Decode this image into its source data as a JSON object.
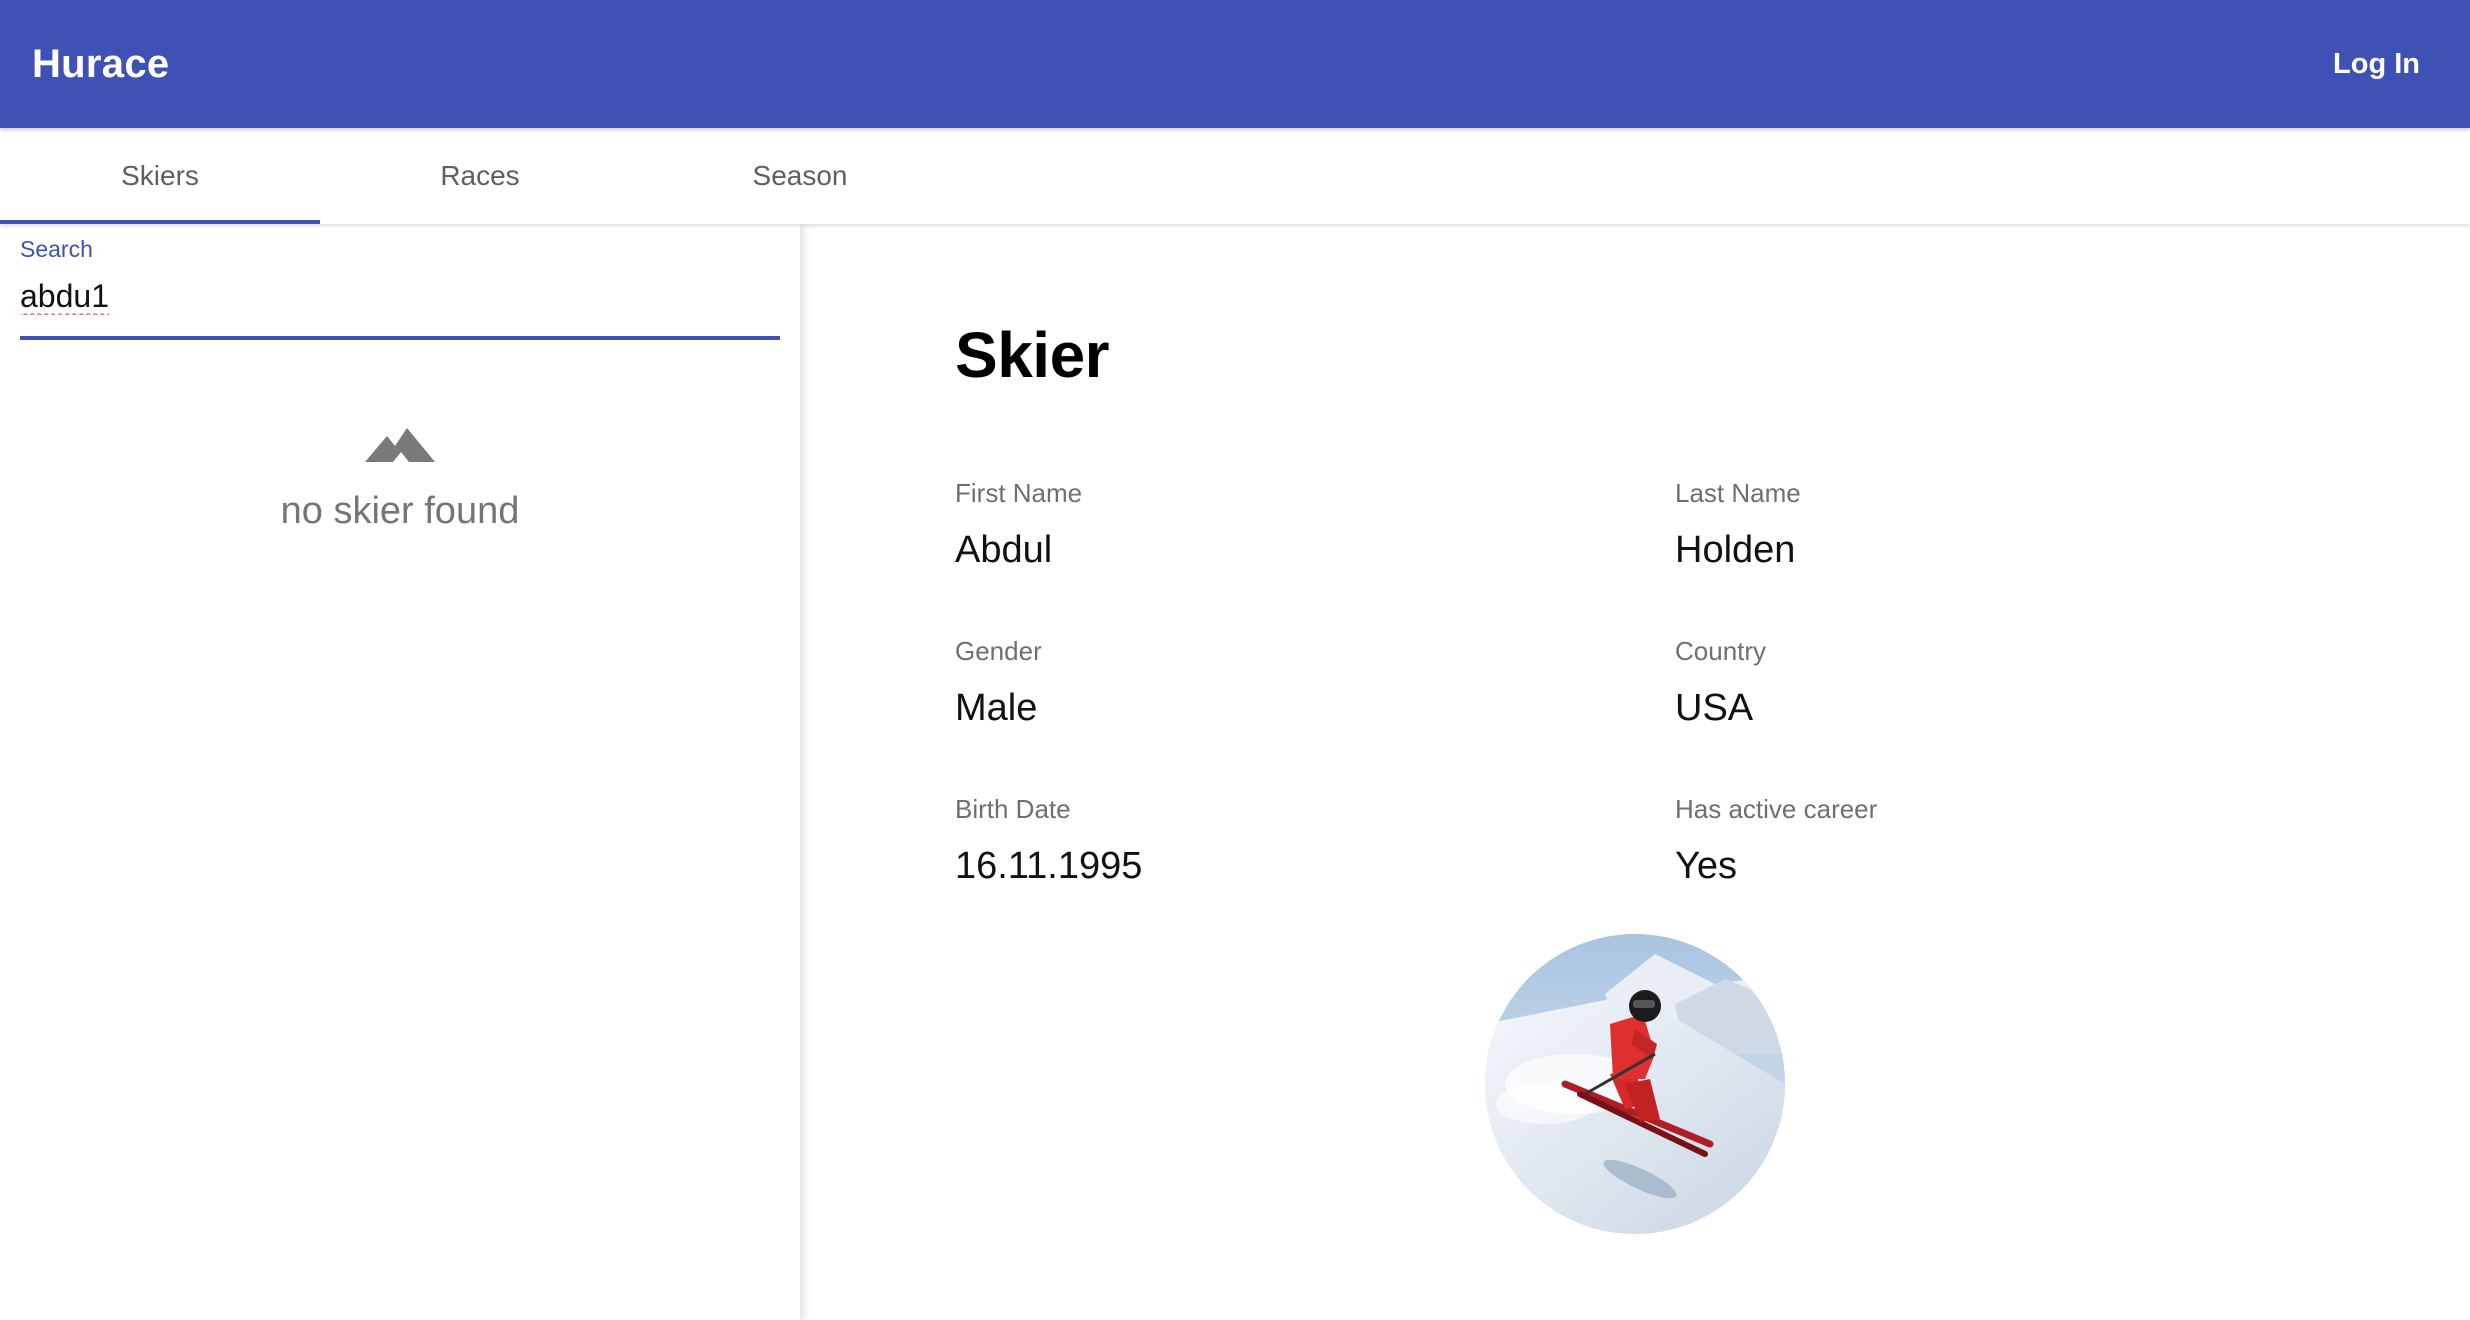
{
  "app": {
    "title": "Hurace",
    "login_label": "Log In"
  },
  "tabs": [
    {
      "label": "Skiers",
      "active": true
    },
    {
      "label": "Races",
      "active": false
    },
    {
      "label": "Season",
      "active": false
    }
  ],
  "search": {
    "label": "Search",
    "value": "abdu1"
  },
  "results": {
    "empty_icon": "mountain-icon",
    "empty_text": "no skier found"
  },
  "detail": {
    "title": "Skier",
    "fields": [
      {
        "label": "First Name",
        "value": "Abdul"
      },
      {
        "label": "Last Name",
        "value": "Holden"
      },
      {
        "label": "Gender",
        "value": "Male"
      },
      {
        "label": "Country",
        "value": "USA"
      },
      {
        "label": "Birth Date",
        "value": "16.11.1995"
      },
      {
        "label": "Has active career",
        "value": "Yes"
      }
    ],
    "photo": "skier-photo"
  },
  "colors": {
    "primary": "#3f51b5",
    "muted_text": "#757575",
    "spellcheck": "#e53935"
  }
}
